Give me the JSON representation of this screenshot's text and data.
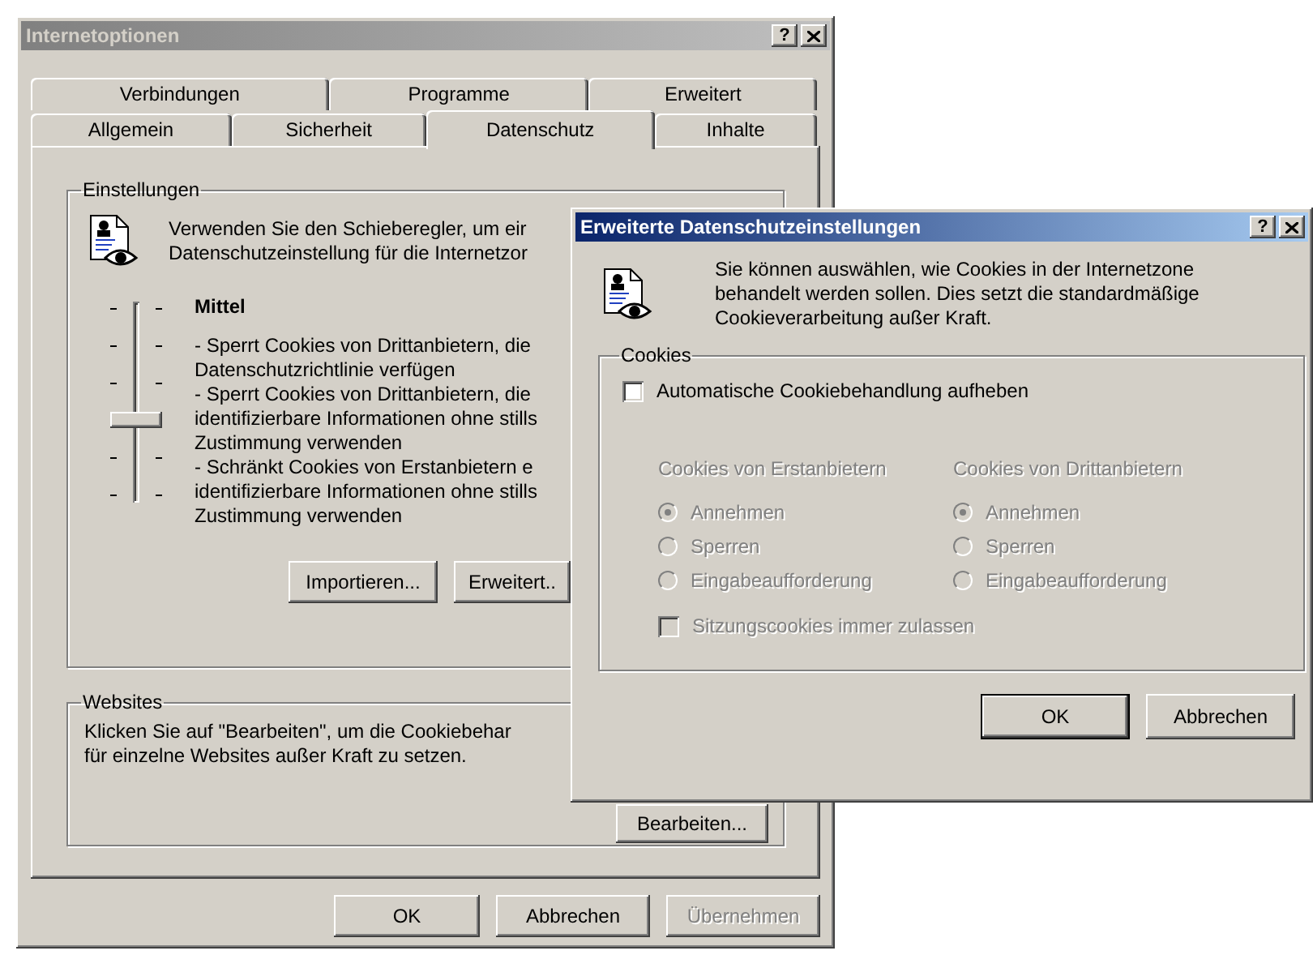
{
  "main_window": {
    "title": "Internetoptionen",
    "active": false,
    "help_label": "?",
    "tab_rows": [
      [
        {
          "label": "Verbindungen",
          "selected": false
        },
        {
          "label": "Programme",
          "selected": false
        },
        {
          "label": "Erweitert",
          "selected": false
        }
      ],
      [
        {
          "label": "Allgemein",
          "selected": false
        },
        {
          "label": "Sicherheit",
          "selected": false
        },
        {
          "label": "Datenschutz",
          "selected": true
        },
        {
          "label": "Inhalte",
          "selected": false
        }
      ]
    ],
    "settings": {
      "title": "Einstellungen",
      "intro_lines": [
        "Verwenden Sie den Schieberegler, um eir",
        "Datenschutzeinstellung für die Internetzor"
      ],
      "slider": {
        "level": 0.4
      },
      "level_name": "Mittel",
      "description_lines": [
        "- Sperrt Cookies von Drittanbietern, die",
        "Datenschutzrichtlinie verfügen",
        "- Sperrt Cookies von Drittanbietern, die",
        "identifizierbare Informationen ohne stills",
        "Zustimmung verwenden",
        "- Schränkt Cookies von Erstanbietern e",
        "identifizierbare Informationen ohne stills",
        "Zustimmung verwenden"
      ],
      "buttons": [
        "Importieren...",
        "Erweitert.."
      ]
    },
    "websites": {
      "title": "Websites",
      "text_lines": [
        "Klicken Sie auf \"Bearbeiten\", um die Cookiebehar",
        "für einzelne Websites außer Kraft zu setzen."
      ],
      "button": "Bearbeiten..."
    },
    "buttons": [
      {
        "label": "OK",
        "disabled": false
      },
      {
        "label": "Abbrechen",
        "disabled": false
      },
      {
        "label": "Übernehmen",
        "disabled": true
      }
    ]
  },
  "dialog": {
    "title": "Erweiterte Datenschutzeinstellungen",
    "active": true,
    "help_label": "?",
    "intro_lines": [
      "Sie können auswählen, wie Cookies in der Internetzone",
      "behandelt werden sollen. Dies setzt die standardmäßige",
      "Cookieverarbeitung außer Kraft."
    ],
    "cookies": {
      "title": "Cookies",
      "override": {
        "label": "Automatische Cookiebehandlung aufheben",
        "checked": false
      },
      "columns": [
        {
          "heading": "Cookies von Erstanbietern",
          "disabled": true,
          "options": [
            {
              "label": "Annehmen",
              "selected": true
            },
            {
              "label": "Sperren",
              "selected": false
            },
            {
              "label": "Eingabeaufforderung",
              "selected": false
            }
          ]
        },
        {
          "heading": "Cookies von Drittanbietern",
          "disabled": true,
          "options": [
            {
              "label": "Annehmen",
              "selected": true
            },
            {
              "label": "Sperren",
              "selected": false
            },
            {
              "label": "Eingabeaufforderung",
              "selected": false
            }
          ]
        }
      ],
      "session": {
        "label": "Sitzungscookies immer zulassen",
        "checked": false,
        "disabled": true
      }
    },
    "buttons": [
      {
        "label": "OK",
        "default": true
      },
      {
        "label": "Abbrechen",
        "default": false
      }
    ]
  }
}
